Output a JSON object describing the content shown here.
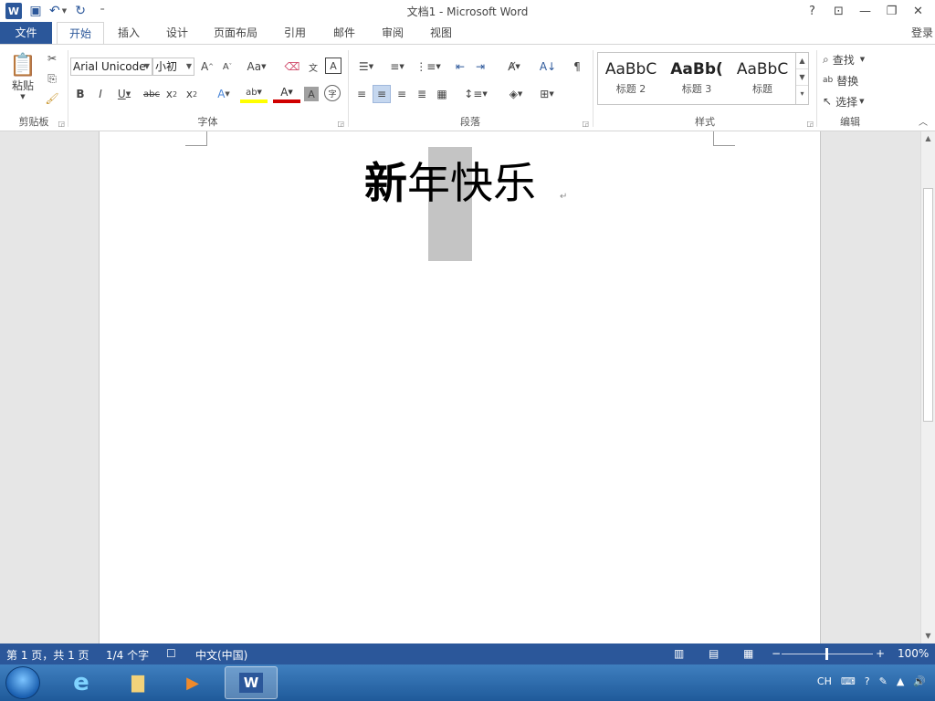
{
  "window": {
    "title": "文档1 - Microsoft Word",
    "controls": {
      "help": "?",
      "ribbon_options": "⊡",
      "minimize": "—",
      "restore": "❐",
      "close": "✕"
    }
  },
  "qat": {
    "logo": "W",
    "save": "▣",
    "undo": "↶",
    "redo": "↻",
    "customize": "⁼"
  },
  "tabs": [
    {
      "label": "文件"
    },
    {
      "label": "开始"
    },
    {
      "label": "插入"
    },
    {
      "label": "设计"
    },
    {
      "label": "页面布局"
    },
    {
      "label": "引用"
    },
    {
      "label": "邮件"
    },
    {
      "label": "审阅"
    },
    {
      "label": "视图"
    }
  ],
  "login": "登录",
  "ribbon": {
    "clipboard": {
      "label": "剪贴板",
      "paste": "粘贴"
    },
    "font": {
      "label": "字体",
      "font_name": "Arial Unicode",
      "font_size": "小初"
    },
    "paragraph": {
      "label": "段落"
    },
    "styles": {
      "label": "样式",
      "items": [
        {
          "sample": "AaBbC",
          "name": "标题 2"
        },
        {
          "sample": "AaBb(",
          "name": "标题 3"
        },
        {
          "sample": "AaBbC",
          "name": "标题"
        }
      ]
    },
    "editing": {
      "label": "编辑",
      "find": "查找",
      "replace": "替换",
      "select": "选择"
    }
  },
  "document": {
    "chars": [
      "新",
      "年",
      "快",
      "乐"
    ],
    "selected_index": 1
  },
  "status": {
    "page": "第 1 页，共 1 页",
    "words": "1/4 个字",
    "language": "中文(中国)",
    "zoom": "100%",
    "zoom_minus": "−",
    "zoom_plus": "+"
  },
  "taskbar": {
    "tray_lang": "CH"
  }
}
